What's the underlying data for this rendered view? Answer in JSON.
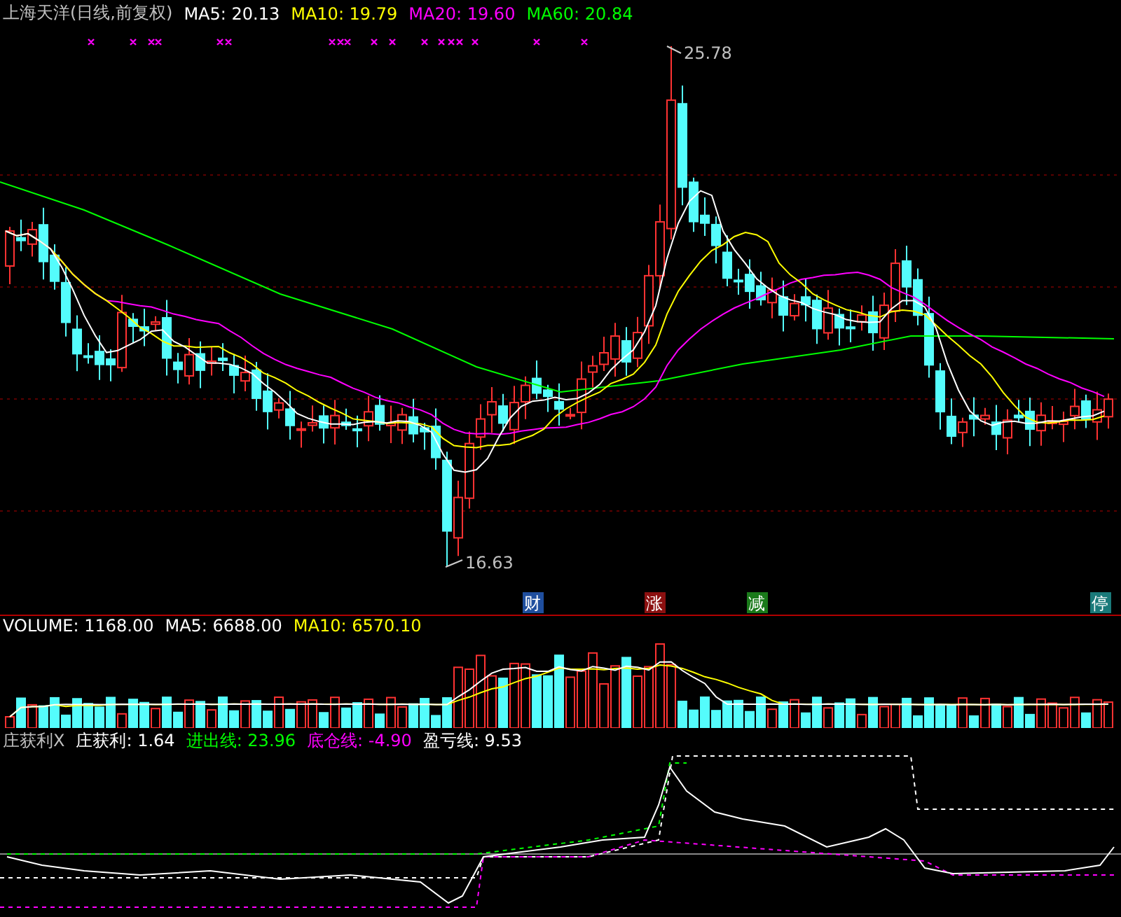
{
  "price_panel": {
    "title": "上海天洋(日线,前复权)",
    "legend": [
      {
        "label": "MA5: 20.13",
        "color": "#ffffff"
      },
      {
        "label": "MA10: 19.79",
        "color": "#ffff00"
      },
      {
        "label": "MA20: 19.60",
        "color": "#ff00ff"
      },
      {
        "label": "MA60: 20.84",
        "color": "#00ff00"
      }
    ],
    "high_label": "25.78",
    "low_label": "16.63",
    "events": [
      {
        "label": "财",
        "color": "#1f4e9e"
      },
      {
        "label": "涨",
        "color": "#8b1010"
      },
      {
        "label": "减",
        "color": "#1a7a1a"
      },
      {
        "label": "停",
        "color": "#1a7a7a"
      }
    ]
  },
  "volume_panel": {
    "legend": [
      {
        "label": "VOLUME: 1168.00",
        "color": "#ffffff"
      },
      {
        "label": "MA5: 6688.00",
        "color": "#ffffff"
      },
      {
        "label": "MA10: 6570.10",
        "color": "#ffff00"
      }
    ]
  },
  "indicator_panel": {
    "title": "庄获利X",
    "legend": [
      {
        "label": "庄获利: 1.64",
        "color": "#ffffff"
      },
      {
        "label": "进出线: 23.96",
        "color": "#00ff00"
      },
      {
        "label": "底仓线: -4.90",
        "color": "#ff00ff"
      },
      {
        "label": "盈亏线: 9.53",
        "color": "#ffffff"
      }
    ]
  }
}
